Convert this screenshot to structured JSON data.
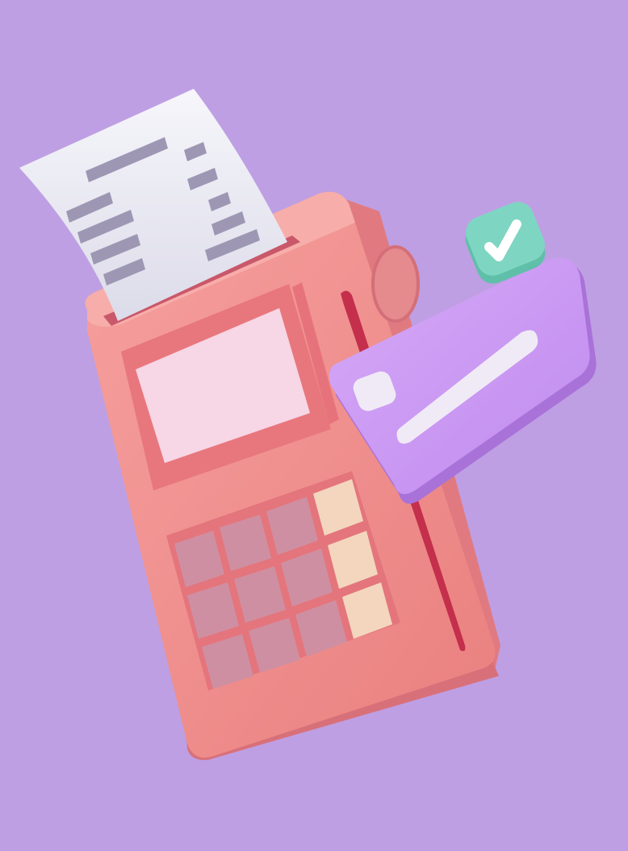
{
  "image": {
    "subject": "payment-terminal-with-receipt-and-credit-card",
    "style": "3d-render",
    "colors": {
      "background": "#be9fe3",
      "terminal_body": "#ef8f8f",
      "terminal_top": "#f6a5a3",
      "terminal_shadow": "#d9707a",
      "screen": "#f7d6e6",
      "key": "#cf8fa2",
      "key_accent": "#f3d6bd",
      "card_slot": "#c42f4c",
      "receipt": "#e9e8f3",
      "receipt_lines": "#9d97b4",
      "credit_card": "#cc9bf3",
      "card_chip": "#f0eaf6",
      "card_stripe": "#f0eaf6",
      "check_badge": "#7ed6c2",
      "check_mark": "#ffffff"
    },
    "icons": [
      "receipt-icon",
      "credit-card-icon",
      "check-icon"
    ],
    "keypad_layout": {
      "rows": 3,
      "columns": 4,
      "accent_column": 4
    }
  }
}
